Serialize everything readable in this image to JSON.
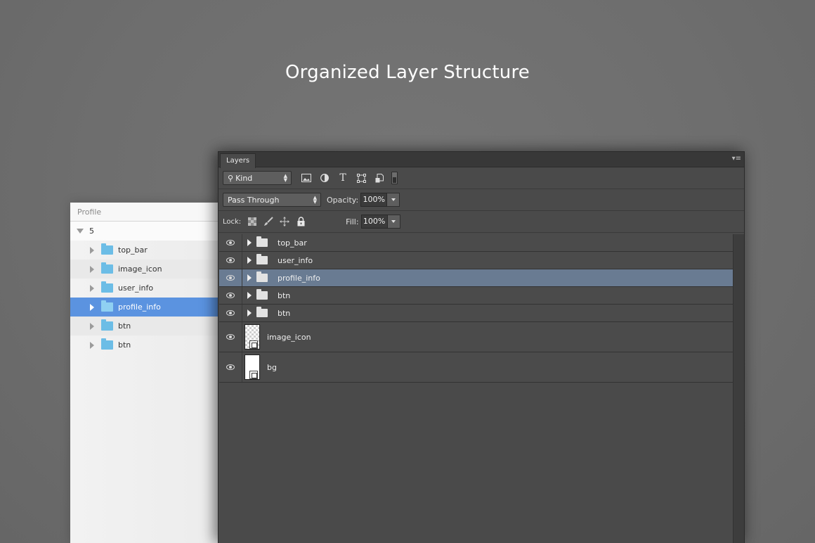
{
  "headline": "Organized Layer Structure",
  "sketch": {
    "header": "Profile",
    "root_label": "5",
    "items": [
      {
        "label": "top_bar"
      },
      {
        "label": "image_icon"
      },
      {
        "label": "user_info"
      },
      {
        "label": "profile_info"
      },
      {
        "label": "btn"
      },
      {
        "label": "btn"
      }
    ],
    "selected": "profile_info"
  },
  "photoshop": {
    "tab": "Layers",
    "filter": {
      "kind_label": "Kind"
    },
    "blend_mode": "Pass Through",
    "opacity_label": "Opacity:",
    "opacity_value": "100%",
    "lock_label": "Lock:",
    "fill_label": "Fill:",
    "fill_value": "100%",
    "layers": [
      {
        "name": "top_bar",
        "type": "group"
      },
      {
        "name": "user_info",
        "type": "group"
      },
      {
        "name": "profile_info",
        "type": "group"
      },
      {
        "name": "btn",
        "type": "group"
      },
      {
        "name": "btn",
        "type": "group"
      },
      {
        "name": "image_icon",
        "type": "smart-object"
      },
      {
        "name": "bg",
        "type": "smart-object"
      }
    ],
    "selected_layer": "profile_info"
  },
  "colors": {
    "selection_sketch": "#5b93e0",
    "selection_ps": "#697b92",
    "folder_sketch": "#6cbde6"
  }
}
